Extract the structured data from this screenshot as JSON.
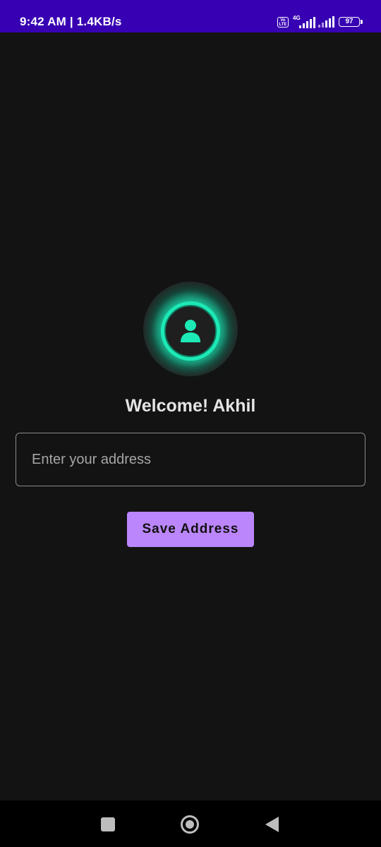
{
  "status_bar": {
    "time_speed": "9:42 AM | 1.4KB/s",
    "volte_label": "Vo LTE",
    "network_type": "4G",
    "battery_level": "97",
    "background_color": "#3700b3"
  },
  "profile": {
    "avatar_icon": "person-icon",
    "accent_color": "#1de9b6"
  },
  "welcome_text": "Welcome! Akhil",
  "address_field": {
    "value": "",
    "placeholder": "Enter your address"
  },
  "save_button": {
    "label": "Save Address",
    "color": "#bb86fc"
  },
  "nav_bar": {
    "recents_icon": "square-recents-icon",
    "home_icon": "circle-home-icon",
    "back_icon": "triangle-back-icon"
  }
}
